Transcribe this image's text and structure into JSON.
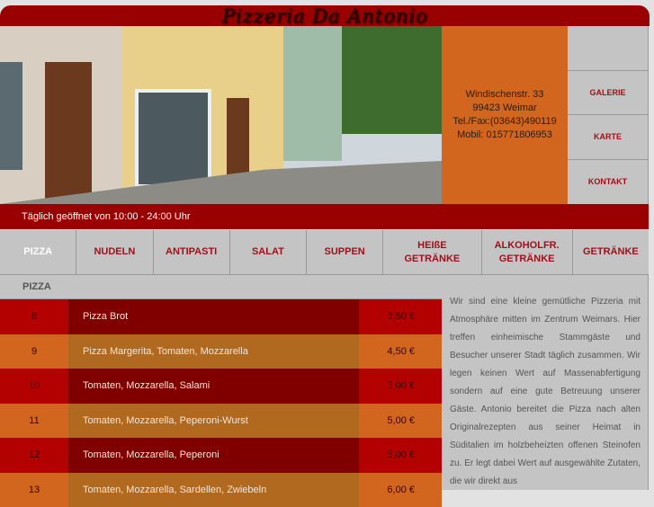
{
  "header": {
    "title": "Pizzeria Da Antonio"
  },
  "address": {
    "lines": [
      "Windischenstr. 33",
      "99423 Weimar",
      "Tel./Fax:(03643)490119",
      "Mobil: 015771806953"
    ]
  },
  "nav": {
    "items": [
      "GALERIE",
      "KARTE",
      "KONTAKT"
    ]
  },
  "hours": "Täglich geöffnet von 10:00 - 24:00 Uhr",
  "tabs": [
    "PIZZA",
    "NUDELN",
    "ANTIPASTI",
    "SALAT",
    "SUPPEN",
    "HEIßE GETRÄNKE",
    "ALKOHOLFR. GETRÄNKE",
    "GETRÄNKE"
  ],
  "section": "PIZZA",
  "menu": [
    {
      "num": "8",
      "desc": "Pizza Brot",
      "price": "3,50 €"
    },
    {
      "num": "9",
      "desc": "Pizza Margerita, Tomaten, Mozzarella",
      "price": "4,50 €"
    },
    {
      "num": "10",
      "desc": "Tomaten, Mozzarella, Salami",
      "price": "5,00 €"
    },
    {
      "num": "11",
      "desc": "Tomaten, Mozzarella, Peperoni-Wurst",
      "price": "5,00 €"
    },
    {
      "num": "12",
      "desc": "Tomaten, Mozzarella, Peperoni",
      "price": "5,00 €"
    },
    {
      "num": "13",
      "desc": "Tomaten, Mozzarella, Sardellen, Zwiebeln",
      "price": "6,00 €"
    }
  ],
  "about": "Wir sind eine kleine gemütliche Pizzeria mit Atmosphäre mitten im Zentrum Weimars. Hier treffen einheimische Stammgäste und Besucher unserer Stadt täglich zusammen. Wir legen keinen Wert auf Massenabfertigung sondern auf eine gute Betreuung unserer Gäste. Antonio bereitet die Pizza nach alten Originalrezepten aus seiner Heimat in Süditalien im holzbeheizten offenen Steinofen zu. Er legt dabei Wert auf ausgewählte Zutaten, die wir direkt aus",
  "colors": {
    "red": "#990000",
    "orange": "#d2661e",
    "gray": "#c4c4c4",
    "link": "#a0101a"
  }
}
